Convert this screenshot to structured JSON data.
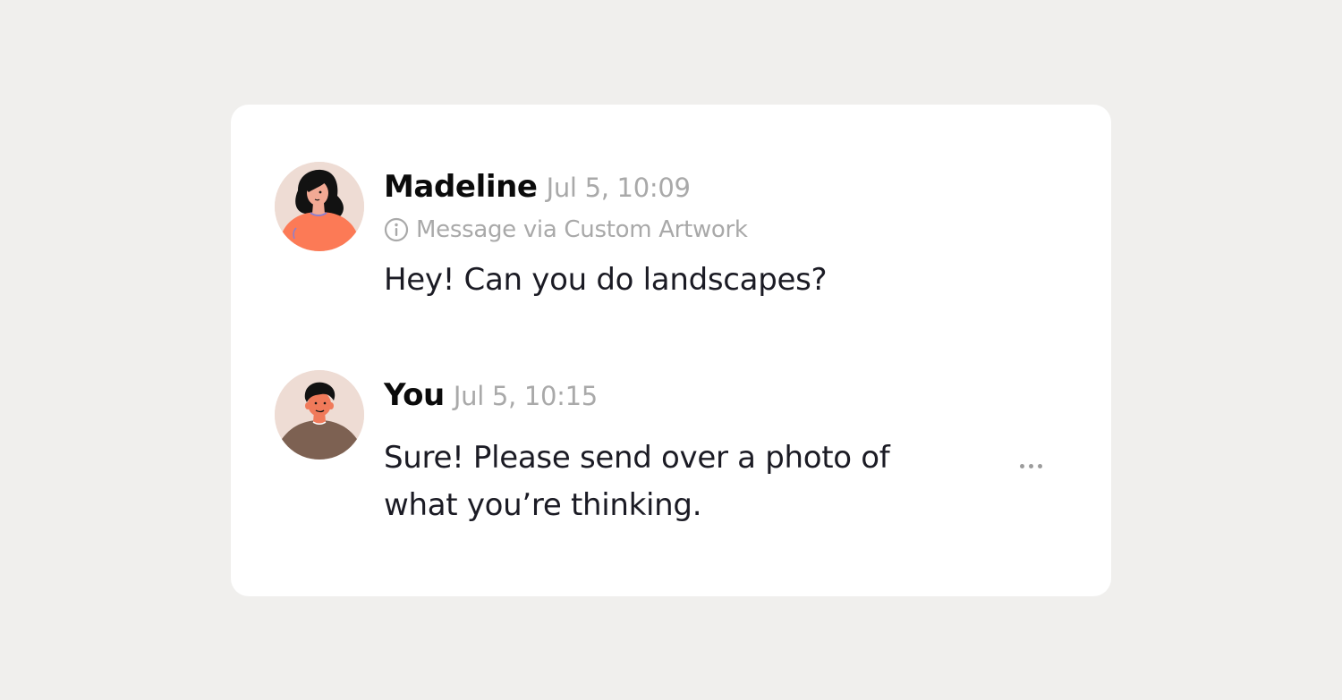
{
  "conversation": {
    "messages": [
      {
        "sender": "Madeline",
        "timestamp": "Jul 5, 10:09",
        "via": "Message via Custom Artwork",
        "text": "Hey! Can you do landscapes?",
        "avatar": "woman-avatar-icon"
      },
      {
        "sender": "You",
        "timestamp": "Jul 5, 10:15",
        "text": "Sure! Please send over a photo of what you’re thinking.",
        "avatar": "man-avatar-icon"
      }
    ]
  },
  "colors": {
    "page_background": "#f0efed",
    "card_background": "#ffffff",
    "name_text": "#0b0b0b",
    "meta_text": "#a9a9a9",
    "body_text": "#1b1b24",
    "avatar_background": "#eedcd4",
    "madeline_shirt": "#fc7a56",
    "you_shirt": "#7d6152"
  }
}
